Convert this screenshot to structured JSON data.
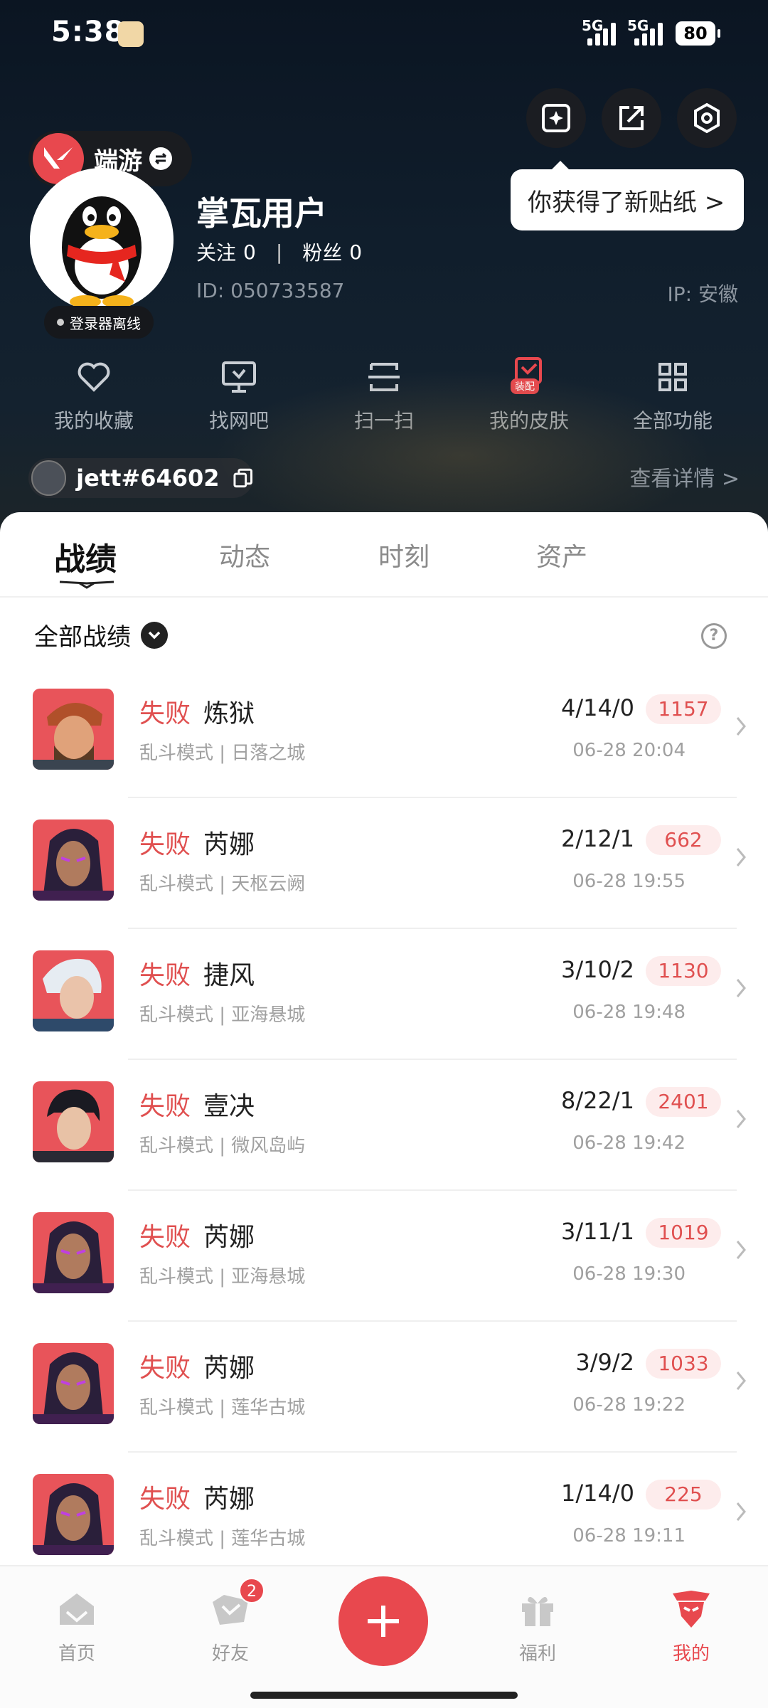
{
  "status_bar": {
    "time": "5:38",
    "network1": "5G",
    "network2": "5G",
    "battery": "80"
  },
  "header": {
    "game_switch": "端游",
    "username": "掌瓦用户",
    "follow_label": "关注",
    "follow_count": "0",
    "fans_label": "粉丝",
    "fans_count": "0",
    "user_id": "ID: 050733587",
    "ip": "IP: 安徽",
    "login_status": "登录器离线",
    "tooltip": "你获得了新贴纸 >",
    "player_tag": "jett#64602",
    "details_link": "查看详情 >"
  },
  "quick_actions": [
    {
      "label": "我的收藏",
      "icon": "heart-icon"
    },
    {
      "label": "找网吧",
      "icon": "monitor-icon"
    },
    {
      "label": "扫一扫",
      "icon": "scan-icon"
    },
    {
      "label": "我的皮肤",
      "icon": "skin-icon",
      "tag": "装配"
    },
    {
      "label": "全部功能",
      "icon": "grid-icon"
    }
  ],
  "tabs": [
    {
      "label": "战绩",
      "active": true
    },
    {
      "label": "动态",
      "active": false
    },
    {
      "label": "时刻",
      "active": false
    },
    {
      "label": "资产",
      "active": false
    }
  ],
  "filter": {
    "label": "全部战绩"
  },
  "matches": [
    {
      "result": "失败",
      "agent": "炼狱",
      "mode": "乱斗模式 | 日落之城",
      "kda": "4/14/0",
      "score": "1157",
      "time": "06-28 20:04"
    },
    {
      "result": "失败",
      "agent": "芮娜",
      "mode": "乱斗模式 | 天枢云阙",
      "kda": "2/12/1",
      "score": "662",
      "time": "06-28 19:55"
    },
    {
      "result": "失败",
      "agent": "捷风",
      "mode": "乱斗模式 | 亚海悬城",
      "kda": "3/10/2",
      "score": "1130",
      "time": "06-28 19:48"
    },
    {
      "result": "失败",
      "agent": "壹决",
      "mode": "乱斗模式 | 微风岛屿",
      "kda": "8/22/1",
      "score": "2401",
      "time": "06-28 19:42"
    },
    {
      "result": "失败",
      "agent": "芮娜",
      "mode": "乱斗模式 | 亚海悬城",
      "kda": "3/11/1",
      "score": "1019",
      "time": "06-28 19:30"
    },
    {
      "result": "失败",
      "agent": "芮娜",
      "mode": "乱斗模式 | 莲华古城",
      "kda": "3/9/2",
      "score": "1033",
      "time": "06-28 19:22"
    },
    {
      "result": "失败",
      "agent": "芮娜",
      "mode": "乱斗模式 | 莲华古城",
      "kda": "1/14/0",
      "score": "225",
      "time": "06-28 19:11"
    }
  ],
  "bottom_nav": [
    {
      "label": "首页"
    },
    {
      "label": "好友",
      "badge": "2"
    },
    {
      "label": "福利"
    },
    {
      "label": "我的",
      "active": true
    }
  ],
  "colors": {
    "accent": "#e8484e",
    "header_bg": "#0b1522",
    "score_bg": "#fdecec"
  }
}
